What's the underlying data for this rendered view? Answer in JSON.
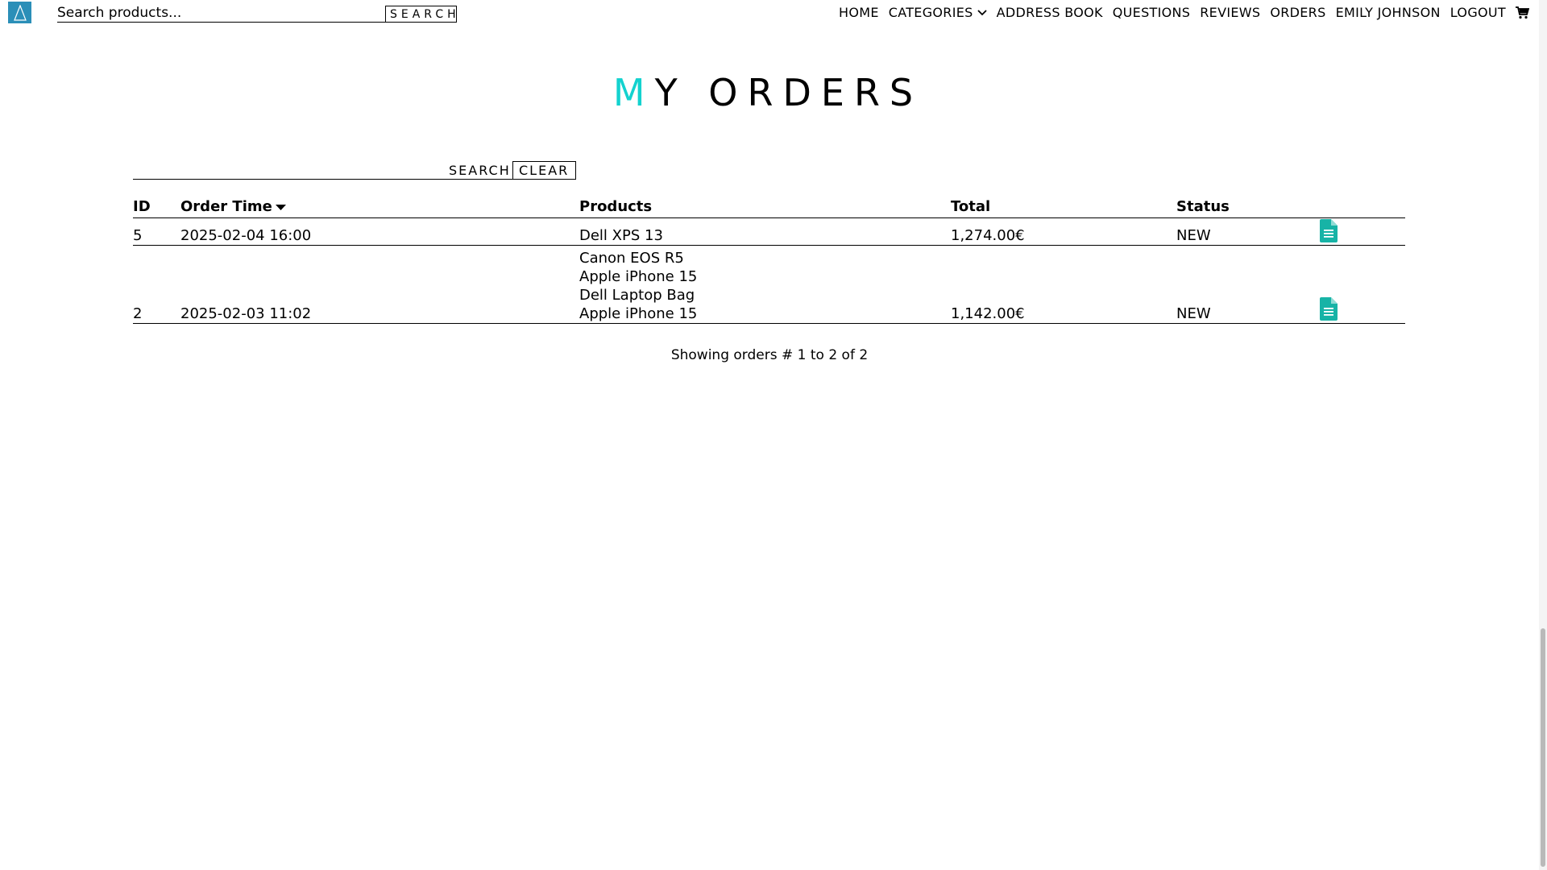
{
  "header": {
    "search_placeholder": "Search products...",
    "search_button": "SEARCH",
    "nav": [
      "HOME",
      "CATEGORIES",
      "ADDRESS BOOK",
      "QUESTIONS",
      "REVIEWS",
      "ORDERS",
      "EMILY JOHNSON",
      "LOGOUT"
    ]
  },
  "page": {
    "title_first": "M",
    "title_rest": "Y ORDERS",
    "accent_color": "#13d2cf"
  },
  "order_search": {
    "value": "",
    "search_button": "SEARCH",
    "clear_button": "CLEAR"
  },
  "table": {
    "headers": [
      "ID",
      "Order Time",
      "Products",
      "Total",
      "Status"
    ],
    "rows": [
      {
        "id": "5",
        "time": "2025-02-04 16:00",
        "products": [
          "Dell XPS 13"
        ],
        "total": "1,274.00€",
        "status": "NEW"
      },
      {
        "id": "2",
        "time": "2025-02-03 11:02",
        "products": [
          "Canon EOS R5",
          "Apple iPhone 15",
          "Dell Laptop Bag",
          "Apple iPhone 15"
        ],
        "total": "1,142.00€",
        "status": "NEW"
      }
    ]
  },
  "footer": {
    "summary": "Showing orders # 1 to 2 of 2"
  },
  "icons": {
    "logo": "triangle-logo-icon",
    "cart": "cart-icon",
    "invoice": "document-icon",
    "sort": "sort-desc-icon",
    "chevron": "chevron-down-icon"
  }
}
